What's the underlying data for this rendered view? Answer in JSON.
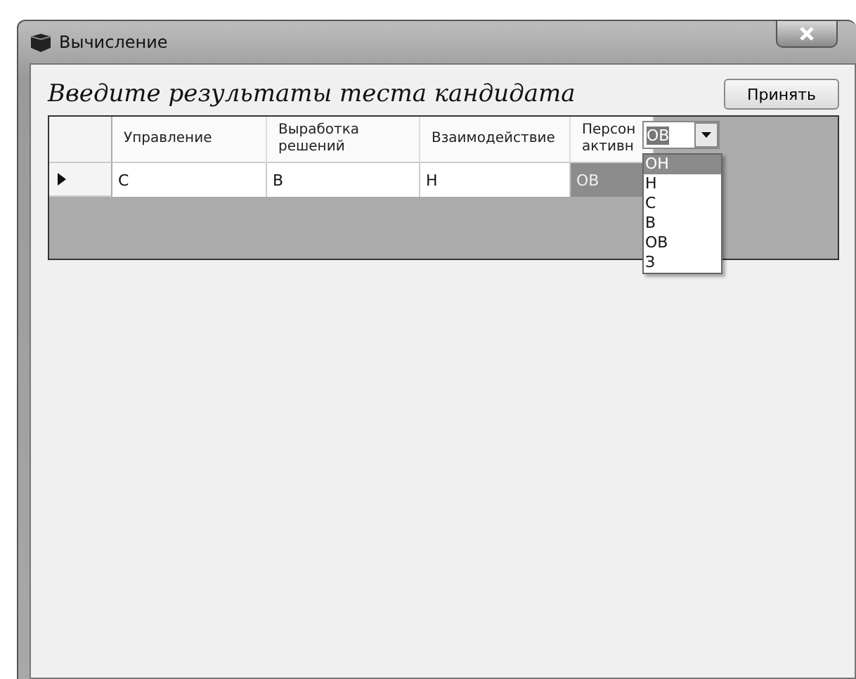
{
  "window": {
    "title": "Вычисление"
  },
  "heading": "Введите результаты теста кандидата",
  "accept_button": "Принять",
  "table": {
    "columns": [
      "Управление",
      "Выработка решений",
      "Взаимодействие",
      "Персон активн"
    ],
    "rows": [
      {
        "selected": true,
        "cells": [
          "С",
          "В",
          "Н",
          "ОВ"
        ]
      }
    ]
  },
  "combo": {
    "value": "ОВ",
    "options": [
      {
        "label": "ОН",
        "highlighted": true
      },
      {
        "label": "Н",
        "highlighted": false
      },
      {
        "label": "С",
        "highlighted": false
      },
      {
        "label": "В",
        "highlighted": false
      },
      {
        "label": "ОВ",
        "highlighted": false
      },
      {
        "label": "З",
        "highlighted": false
      }
    ]
  }
}
